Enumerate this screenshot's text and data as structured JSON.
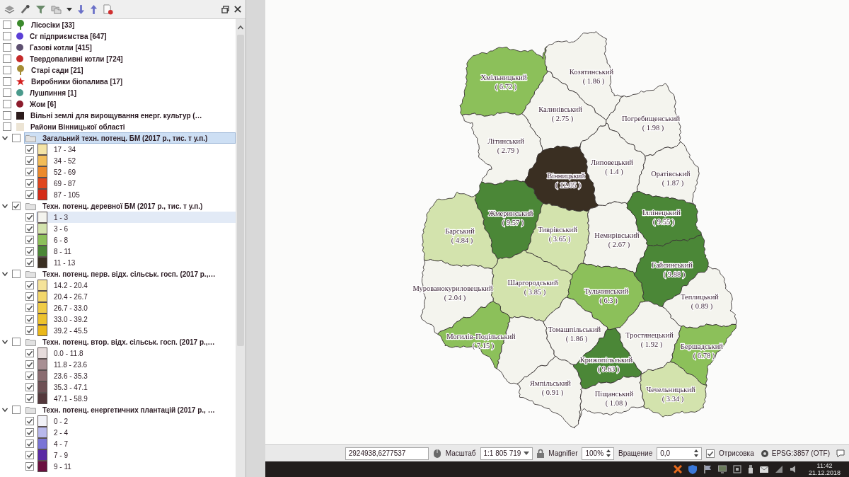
{
  "layers_panel": {
    "layers": [
      {
        "kind": "tree",
        "label": "Лісосіки [33]",
        "checked": false,
        "selected": false,
        "color": "#3b8a2c"
      },
      {
        "kind": "dot",
        "label": "Сг підприємства [647]",
        "checked": false,
        "selected": false,
        "color": "#5b3fd6"
      },
      {
        "kind": "dot",
        "label": "Газові котли [415]",
        "checked": false,
        "selected": false,
        "color": "#5e5070"
      },
      {
        "kind": "dot",
        "label": "Твердопаливні котли [724]",
        "checked": false,
        "selected": false,
        "color": "#c52b2b"
      },
      {
        "kind": "tree",
        "label": "Старі сади [21]",
        "checked": false,
        "selected": false,
        "color": "#a58d35"
      },
      {
        "kind": "star",
        "label": "Виробники біопалива [17]",
        "checked": false,
        "selected": false,
        "color": "#d42020"
      },
      {
        "kind": "dot",
        "label": "Лушпиння [1]",
        "checked": false,
        "selected": false,
        "color": "#4a9a8c"
      },
      {
        "kind": "dot",
        "label": "Жом [6]",
        "checked": false,
        "selected": false,
        "color": "#8c1c2c"
      },
      {
        "kind": "square",
        "label": "Вільні землі для вирощування енерг. культур (…",
        "checked": false,
        "selected": false,
        "color": "#2c1c1c"
      },
      {
        "kind": "square",
        "label": "Райони Вінницької області",
        "checked": false,
        "selected": false,
        "color": "#ece4d4"
      },
      {
        "kind": "group",
        "label": "Загальний техн. потенц. БМ (2017 р., тис. т у.п.)",
        "checked": false,
        "selected": true,
        "expanded": true,
        "classes": [
          {
            "label": "17 - 34",
            "checked": true,
            "selected": false,
            "color": "#f4e4a6"
          },
          {
            "label": "34 - 52",
            "checked": true,
            "selected": false,
            "color": "#f2bc58"
          },
          {
            "label": "52 - 69",
            "checked": true,
            "selected": false,
            "color": "#ec8a2c"
          },
          {
            "label": "69 - 87",
            "checked": true,
            "selected": false,
            "color": "#e0461e"
          },
          {
            "label": "87 - 105",
            "checked": true,
            "selected": false,
            "color": "#d42c18"
          }
        ]
      },
      {
        "kind": "group",
        "label": "Техн. потенц. деревної БМ (2017 р., тис. т у.п.)",
        "checked": true,
        "selected": false,
        "expanded": true,
        "classes": [
          {
            "label": "1 - 3",
            "checked": true,
            "selected": true,
            "color": "#f4f4ee"
          },
          {
            "label": "3 - 6",
            "checked": true,
            "selected": false,
            "color": "#d3e3ad"
          },
          {
            "label": "6 - 8",
            "checked": true,
            "selected": false,
            "color": "#8cc05a"
          },
          {
            "label": "8 - 11",
            "checked": true,
            "selected": false,
            "color": "#4b8737"
          },
          {
            "label": "11 - 13",
            "checked": true,
            "selected": false,
            "color": "#3a2f22"
          }
        ]
      },
      {
        "kind": "group",
        "label": "Техн. потенц. перв. відх. сільськ. госп. (2017 р.,…",
        "checked": false,
        "selected": false,
        "expanded": true,
        "classes": [
          {
            "label": "14.2 - 20.4",
            "checked": true,
            "selected": false,
            "color": "#f5e39a"
          },
          {
            "label": "20.4 - 26.7",
            "checked": true,
            "selected": false,
            "color": "#f3d76a"
          },
          {
            "label": "26.7 - 33.0",
            "checked": true,
            "selected": false,
            "color": "#f0cc45"
          },
          {
            "label": "33.0 - 39.2",
            "checked": true,
            "selected": false,
            "color": "#edc22c"
          },
          {
            "label": "39.2 - 45.5",
            "checked": true,
            "selected": false,
            "color": "#eab81a"
          }
        ]
      },
      {
        "kind": "group",
        "label": "Техн. потенц. втор. відх. сільськ. госп. (2017 р.,…",
        "checked": false,
        "selected": false,
        "expanded": true,
        "classes": [
          {
            "label": "0.0 - 11.8",
            "checked": true,
            "selected": false,
            "color": "#e6dcdc"
          },
          {
            "label": "11.8 - 23.6",
            "checked": true,
            "selected": false,
            "color": "#a88f93"
          },
          {
            "label": "23.6 - 35.3",
            "checked": true,
            "selected": false,
            "color": "#8a6c70"
          },
          {
            "label": "35.3 - 47.1",
            "checked": true,
            "selected": false,
            "color": "#6e5055"
          },
          {
            "label": "47.1 - 58.9",
            "checked": true,
            "selected": false,
            "color": "#54383c"
          }
        ]
      },
      {
        "kind": "group",
        "label": "Техн. потенц. енергетичних плантацій (2017 р., …",
        "checked": false,
        "selected": false,
        "expanded": true,
        "classes": [
          {
            "label": "0 - 2",
            "checked": true,
            "selected": false,
            "color": "#f2f2f8"
          },
          {
            "label": "2 - 4",
            "checked": true,
            "selected": false,
            "color": "#b8b8ec"
          },
          {
            "label": "4 - 7",
            "checked": true,
            "selected": false,
            "color": "#7a74d6"
          },
          {
            "label": "7 - 9",
            "checked": true,
            "selected": false,
            "color": "#5a2aa4"
          },
          {
            "label": "9 - 11",
            "checked": true,
            "selected": false,
            "color": "#6a1040"
          }
        ]
      }
    ]
  },
  "map": {
    "districts": [
      {
        "name": "Хмільницький",
        "value": "( 6.72 )",
        "color": "#8cc05a"
      },
      {
        "name": "Козятинський",
        "value": "( 1.86 )",
        "color": "#f4f4ee"
      },
      {
        "name": "Калинівський",
        "value": "( 2.75 )",
        "color": "#f4f4ee"
      },
      {
        "name": "Погребищенський",
        "value": "( 1.98 )",
        "color": "#f4f4ee"
      },
      {
        "name": "Літинський",
        "value": "( 2.79 )",
        "color": "#f4f4ee"
      },
      {
        "name": "Вінницький",
        "value": "( 12.05 )",
        "color": "#3a2f22"
      },
      {
        "name": "Липовецький",
        "value": "( 1.4 )",
        "color": "#f4f4ee"
      },
      {
        "name": "Оратівський",
        "value": "( 1.87 )",
        "color": "#f4f4ee"
      },
      {
        "name": "Жмеринський",
        "value": "( 9.57 )",
        "color": "#4b8737"
      },
      {
        "name": "Барський",
        "value": "( 4.84 )",
        "color": "#d3e3ad"
      },
      {
        "name": "Тиврівський",
        "value": "( 3.65 )",
        "color": "#d3e3ad"
      },
      {
        "name": "Немирівський",
        "value": "( 2.67 )",
        "color": "#f4f4ee"
      },
      {
        "name": "Іллінецький",
        "value": "( 9.55 )",
        "color": "#4b8737"
      },
      {
        "name": "Мурованокуриловецький",
        "value": "( 2.04 )",
        "color": "#f4f4ee"
      },
      {
        "name": "Шаргородський",
        "value": "( 3.85 )",
        "color": "#d3e3ad"
      },
      {
        "name": "Тульчинський",
        "value": "( 6.3 )",
        "color": "#8cc05a"
      },
      {
        "name": "Гайсинський",
        "value": "( 9.88 )",
        "color": "#4b8737"
      },
      {
        "name": "Теплицький",
        "value": "( 0.89 )",
        "color": "#f4f4ee"
      },
      {
        "name": "Могилів-Подільський",
        "value": "( 7.15 )",
        "color": "#8cc05a"
      },
      {
        "color": "#f4f4ee"
      },
      {
        "name": "Томашпільський",
        "value": "( 1.86 )",
        "color": "#f4f4ee"
      },
      {
        "name": "Тростянецький",
        "value": "( 1.92 )",
        "color": "#f4f4ee"
      },
      {
        "name": "Бершадський",
        "value": "( 6.78 )",
        "color": "#8cc05a"
      },
      {
        "name": "Крижопільський",
        "value": "( 9.63 )",
        "color": "#4b8737"
      },
      {
        "name": "Ямпільський",
        "value": "( 0.91 )",
        "color": "#f4f4ee"
      },
      {
        "name": "Піщанський",
        "value": "( 1.08 )",
        "color": "#f4f4ee"
      },
      {
        "name": "Чечельницький",
        "value": "( 3.34 )",
        "color": "#d3e3ad"
      }
    ]
  },
  "status_bar": {
    "coordinate": "2924938,6277537",
    "scale_label": "Масштаб",
    "scale": "1:1 805 719",
    "magnifier_label": "Magnifier",
    "magnifier": "100%",
    "rotation_label": "Вращение",
    "rotation": "0,0",
    "render": {
      "label": "Отрисовка",
      "checked": true
    },
    "crs": "EPSG:3857 (OTF)"
  },
  "taskbar": {
    "time": "11:42",
    "date": "21.12.2018"
  }
}
